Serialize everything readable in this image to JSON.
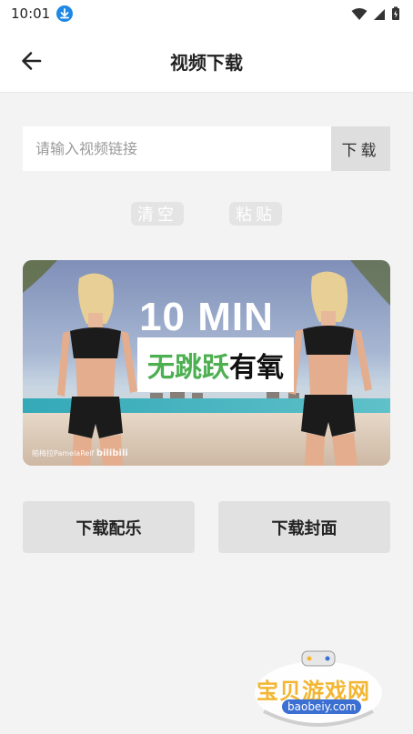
{
  "status_bar": {
    "time": "10:01"
  },
  "app_bar": {
    "title": "视频下载"
  },
  "url_input": {
    "placeholder": "请输入视频链接",
    "value": ""
  },
  "buttons": {
    "download": "下载",
    "clear": "清空",
    "paste": "粘贴",
    "download_music": "下载配乐",
    "download_cover": "下载封面"
  },
  "thumbnail": {
    "title_big": "10 MIN",
    "subtitle_green": "无跳跃",
    "subtitle_black": "有氧",
    "uploader_tag": "帕梅拉PamelaReif",
    "platform_tag": "bilibili"
  },
  "site_watermark": {
    "name": "宝贝游戏网",
    "url": "baobeiy.com"
  }
}
